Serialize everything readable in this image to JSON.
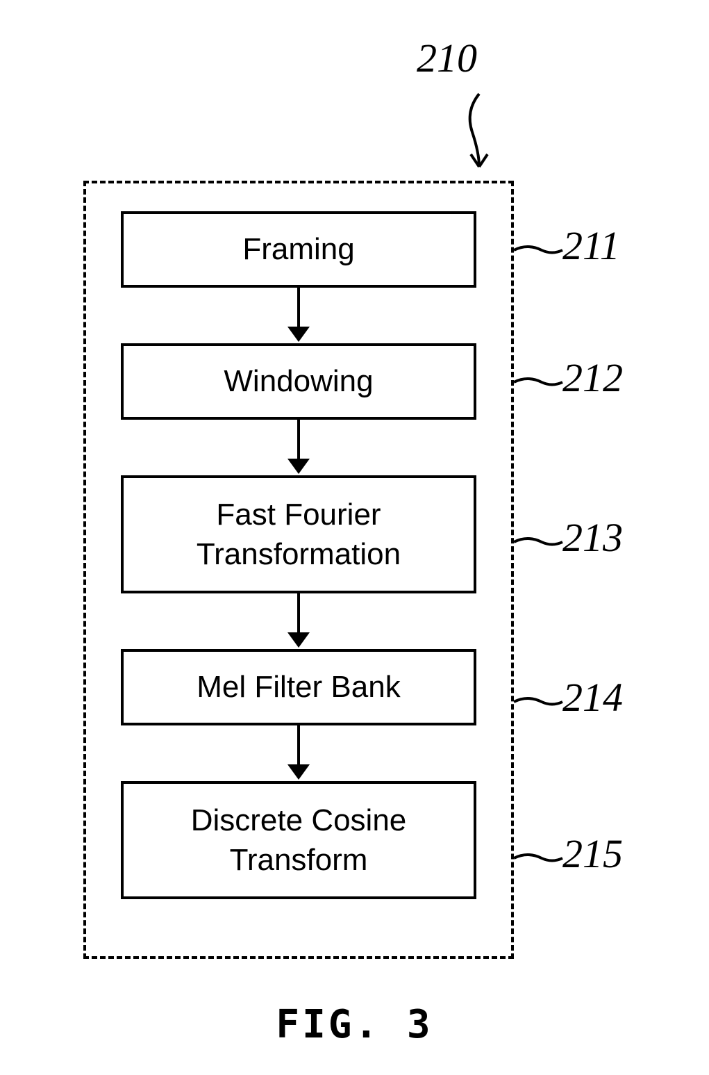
{
  "diagram": {
    "mainLabel": "210",
    "blocks": [
      {
        "id": "211",
        "label": "Framing"
      },
      {
        "id": "212",
        "label": "Windowing"
      },
      {
        "id": "213",
        "label": "Fast Fourier\nTransformation"
      },
      {
        "id": "214",
        "label": "Mel Filter Bank"
      },
      {
        "id": "215",
        "label": "Discrete Cosine\nTransform"
      }
    ],
    "caption": "FIG. 3"
  }
}
